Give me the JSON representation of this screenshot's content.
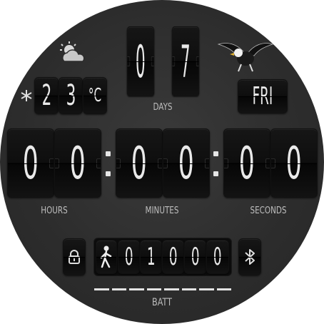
{
  "date": {
    "day_digits": [
      "0",
      "7"
    ],
    "label": "DAYS"
  },
  "weekday": "FRI",
  "weather": {
    "icon": "partly-cloudy-icon",
    "temp_digits": [
      "2",
      "3"
    ],
    "unit": "°C",
    "condition_icon": "snowflake-icon"
  },
  "time": {
    "hours": [
      "0",
      "0"
    ],
    "minutes": [
      "0",
      "0"
    ],
    "seconds": [
      "0",
      "0"
    ],
    "labels": {
      "hours": "HOURS",
      "minutes": "MINUTES",
      "seconds": "SECONDS"
    }
  },
  "steps": {
    "icon": "walking-person-icon",
    "digits": [
      "0",
      "1",
      "0",
      "0",
      "0"
    ]
  },
  "status": {
    "lock_icon": "lock-icon",
    "bluetooth_icon": "bluetooth-icon"
  },
  "battery": {
    "label": "BATT",
    "segments": 8,
    "level_fraction": 1.0
  },
  "logo": "eagle-logo"
}
